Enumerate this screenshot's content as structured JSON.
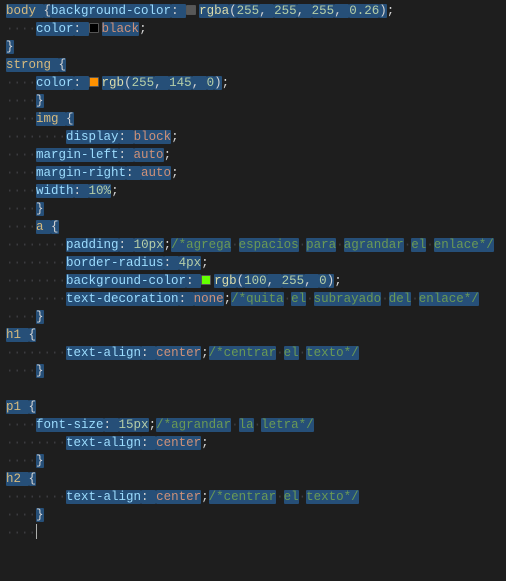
{
  "lines": [
    {
      "indent": 0,
      "segs": [
        {
          "t": "body ",
          "c": "sel",
          "hl": true
        },
        {
          "t": "{",
          "c": "punc",
          "hl": true
        },
        {
          "t": "background-color",
          "c": "prop",
          "hl": true
        },
        {
          "t": ": ",
          "c": "punc",
          "hl": true
        },
        {
          "swatch": "rgba(255,255,255,0.26)",
          "hl": true
        },
        {
          "t": "rgba",
          "c": "func",
          "hl": true
        },
        {
          "t": "(",
          "c": "punc",
          "hl": true
        },
        {
          "t": "255",
          "c": "num",
          "hl": true
        },
        {
          "t": ", ",
          "c": "punc",
          "hl": true
        },
        {
          "t": "255",
          "c": "num",
          "hl": true
        },
        {
          "t": ", ",
          "c": "punc",
          "hl": true
        },
        {
          "t": "255",
          "c": "num",
          "hl": true
        },
        {
          "t": ", ",
          "c": "punc",
          "hl": true
        },
        {
          "t": "0.26",
          "c": "num",
          "hl": true
        },
        {
          "t": ")",
          "c": "punc",
          "hl": true
        },
        {
          "t": ";",
          "c": "punc"
        }
      ]
    },
    {
      "indent": 1,
      "segs": [
        {
          "t": "color",
          "c": "prop",
          "hl": true
        },
        {
          "t": ": ",
          "c": "punc",
          "hl": true
        },
        {
          "swatch": "black",
          "hl": true
        },
        {
          "t": "black",
          "c": "val",
          "hl": true
        },
        {
          "t": ";",
          "c": "punc"
        }
      ]
    },
    {
      "indent": 0,
      "segs": [
        {
          "t": "}",
          "c": "punc",
          "hl": true
        }
      ]
    },
    {
      "indent": 0,
      "segs": [
        {
          "t": "strong ",
          "c": "sel",
          "hl": true
        },
        {
          "t": "{",
          "c": "punc",
          "hl": true
        }
      ]
    },
    {
      "indent": 1,
      "segs": [
        {
          "t": "color",
          "c": "prop",
          "hl": true
        },
        {
          "t": ": ",
          "c": "punc",
          "hl": true
        },
        {
          "swatch": "rgb(255,145,0)",
          "hl": true
        },
        {
          "t": "rgb",
          "c": "func",
          "hl": true
        },
        {
          "t": "(",
          "c": "punc",
          "hl": true
        },
        {
          "t": "255",
          "c": "num",
          "hl": true
        },
        {
          "t": ", ",
          "c": "punc",
          "hl": true
        },
        {
          "t": "145",
          "c": "num",
          "hl": true
        },
        {
          "t": ", ",
          "c": "punc",
          "hl": true
        },
        {
          "t": "0",
          "c": "num",
          "hl": true
        },
        {
          "t": ")",
          "c": "punc",
          "hl": true
        },
        {
          "t": ";",
          "c": "punc"
        }
      ]
    },
    {
      "indent": 1,
      "segs": [
        {
          "t": "}",
          "c": "punc",
          "hl": true
        }
      ]
    },
    {
      "indent": 1,
      "segs": [
        {
          "t": "img ",
          "c": "sel",
          "hl": true
        },
        {
          "t": "{",
          "c": "punc",
          "hl": true
        }
      ]
    },
    {
      "indent": 2,
      "segs": [
        {
          "t": "display",
          "c": "prop",
          "hl": true
        },
        {
          "t": ": ",
          "c": "punc",
          "hl": true
        },
        {
          "t": "block",
          "c": "val",
          "hl": true
        },
        {
          "t": ";",
          "c": "punc"
        }
      ]
    },
    {
      "indent": 1,
      "segs": [
        {
          "t": "margin-left",
          "c": "prop",
          "hl": true
        },
        {
          "t": ": ",
          "c": "punc",
          "hl": true
        },
        {
          "t": "auto",
          "c": "val",
          "hl": true
        },
        {
          "t": ";",
          "c": "punc"
        }
      ]
    },
    {
      "indent": 1,
      "segs": [
        {
          "t": "margin-right",
          "c": "prop",
          "hl": true
        },
        {
          "t": ": ",
          "c": "punc",
          "hl": true
        },
        {
          "t": "auto",
          "c": "val",
          "hl": true
        },
        {
          "t": ";",
          "c": "punc"
        }
      ]
    },
    {
      "indent": 1,
      "segs": [
        {
          "t": "width",
          "c": "prop",
          "hl": true
        },
        {
          "t": ": ",
          "c": "punc",
          "hl": true
        },
        {
          "t": "10%",
          "c": "num",
          "hl": true
        },
        {
          "t": ";",
          "c": "punc"
        }
      ]
    },
    {
      "indent": 1,
      "segs": [
        {
          "t": "}",
          "c": "punc",
          "hl": true
        }
      ]
    },
    {
      "indent": 1,
      "segs": [
        {
          "t": "a ",
          "c": "sel",
          "hl": true
        },
        {
          "t": "{",
          "c": "punc",
          "hl": true
        }
      ]
    },
    {
      "indent": 2,
      "segs": [
        {
          "t": "padding",
          "c": "prop",
          "hl": true
        },
        {
          "t": ": ",
          "c": "punc",
          "hl": true
        },
        {
          "t": "10px",
          "c": "num",
          "hl": true
        },
        {
          "t": ";",
          "c": "punc"
        },
        {
          "t": "/*agrega",
          "c": "comment",
          "hl": true
        },
        {
          "ws": true
        },
        {
          "t": "espacios",
          "c": "comment",
          "hl": true
        },
        {
          "ws": true
        },
        {
          "t": "para",
          "c": "comment",
          "hl": true
        },
        {
          "ws": true
        },
        {
          "t": "agrandar",
          "c": "comment",
          "hl": true
        },
        {
          "ws": true
        },
        {
          "t": "el",
          "c": "comment",
          "hl": true
        },
        {
          "ws": true
        },
        {
          "t": "enlace*/",
          "c": "comment",
          "hl": true
        }
      ]
    },
    {
      "indent": 2,
      "segs": [
        {
          "t": "border-radius",
          "c": "prop",
          "hl": true
        },
        {
          "t": ": ",
          "c": "punc",
          "hl": true
        },
        {
          "t": "4px",
          "c": "num",
          "hl": true
        },
        {
          "t": ";",
          "c": "punc"
        }
      ]
    },
    {
      "indent": 2,
      "segs": [
        {
          "t": "background-color",
          "c": "prop",
          "hl": true
        },
        {
          "t": ": ",
          "c": "punc",
          "hl": true
        },
        {
          "swatch": "rgb(100,255,0)",
          "hl": true
        },
        {
          "t": "rgb",
          "c": "func",
          "hl": true
        },
        {
          "t": "(",
          "c": "punc",
          "hl": true
        },
        {
          "t": "100",
          "c": "num",
          "hl": true
        },
        {
          "t": ", ",
          "c": "punc",
          "hl": true
        },
        {
          "t": "255",
          "c": "num",
          "hl": true
        },
        {
          "t": ", ",
          "c": "punc",
          "hl": true
        },
        {
          "t": "0",
          "c": "num",
          "hl": true
        },
        {
          "t": ")",
          "c": "punc",
          "hl": true
        },
        {
          "t": ";",
          "c": "punc"
        }
      ]
    },
    {
      "indent": 2,
      "segs": [
        {
          "t": "text-decoration",
          "c": "prop",
          "hl": true
        },
        {
          "t": ": ",
          "c": "punc",
          "hl": true
        },
        {
          "t": "none",
          "c": "val",
          "hl": true
        },
        {
          "t": ";",
          "c": "punc"
        },
        {
          "t": "/*quita",
          "c": "comment",
          "hl": true
        },
        {
          "ws": true
        },
        {
          "t": "el",
          "c": "comment",
          "hl": true
        },
        {
          "ws": true
        },
        {
          "t": "subrayado",
          "c": "comment",
          "hl": true
        },
        {
          "ws": true
        },
        {
          "t": "del",
          "c": "comment",
          "hl": true
        },
        {
          "ws": true
        },
        {
          "t": "enlace*/",
          "c": "comment",
          "hl": true
        }
      ]
    },
    {
      "indent": 1,
      "segs": [
        {
          "t": "}",
          "c": "punc",
          "hl": true
        }
      ]
    },
    {
      "indent": 0,
      "segs": [
        {
          "t": "h1 ",
          "c": "sel",
          "hl": true
        },
        {
          "t": "{",
          "c": "punc",
          "hl": true
        }
      ]
    },
    {
      "indent": 2,
      "segs": [
        {
          "t": "text-align",
          "c": "prop",
          "hl": true
        },
        {
          "t": ": ",
          "c": "punc",
          "hl": true
        },
        {
          "t": "center",
          "c": "val",
          "hl": true
        },
        {
          "t": ";",
          "c": "punc"
        },
        {
          "t": "/*centrar",
          "c": "comment",
          "hl": true
        },
        {
          "ws": true
        },
        {
          "t": "el",
          "c": "comment",
          "hl": true
        },
        {
          "ws": true
        },
        {
          "t": "texto*/",
          "c": "comment",
          "hl": true
        }
      ]
    },
    {
      "indent": 1,
      "segs": [
        {
          "t": "}",
          "c": "punc",
          "hl": true
        }
      ]
    },
    {
      "indent": 0,
      "segs": []
    },
    {
      "indent": 0,
      "segs": [
        {
          "t": "p1 ",
          "c": "sel",
          "hl": true
        },
        {
          "t": "{",
          "c": "punc",
          "hl": true
        }
      ]
    },
    {
      "indent": 1,
      "segs": [
        {
          "t": "font-size",
          "c": "prop",
          "hl": true
        },
        {
          "t": ": ",
          "c": "punc",
          "hl": true
        },
        {
          "t": "15px",
          "c": "num",
          "hl": true
        },
        {
          "t": ";",
          "c": "punc"
        },
        {
          "t": "/*agrandar",
          "c": "comment",
          "hl": true
        },
        {
          "ws": true
        },
        {
          "t": "la",
          "c": "comment",
          "hl": true
        },
        {
          "ws": true
        },
        {
          "t": "letra*/",
          "c": "comment",
          "hl": true
        }
      ]
    },
    {
      "indent": 2,
      "segs": [
        {
          "t": "text-align",
          "c": "prop",
          "hl": true
        },
        {
          "t": ": ",
          "c": "punc",
          "hl": true
        },
        {
          "t": "center",
          "c": "val",
          "hl": true
        },
        {
          "t": ";",
          "c": "punc"
        }
      ]
    },
    {
      "indent": 1,
      "segs": [
        {
          "t": "}",
          "c": "punc",
          "hl": true
        }
      ]
    },
    {
      "indent": 0,
      "segs": [
        {
          "t": "h2 ",
          "c": "sel",
          "hl": true
        },
        {
          "t": "{",
          "c": "punc",
          "hl": true
        }
      ]
    },
    {
      "indent": 2,
      "segs": [
        {
          "t": "text-align",
          "c": "prop",
          "hl": true
        },
        {
          "t": ": ",
          "c": "punc",
          "hl": true
        },
        {
          "t": "center",
          "c": "val",
          "hl": true
        },
        {
          "t": ";",
          "c": "punc"
        },
        {
          "t": "/*centrar",
          "c": "comment",
          "hl": true
        },
        {
          "ws": true
        },
        {
          "t": "el",
          "c": "comment",
          "hl": true
        },
        {
          "ws": true
        },
        {
          "t": "texto*/",
          "c": "comment",
          "hl": true
        }
      ]
    },
    {
      "indent": 1,
      "segs": [
        {
          "t": "}",
          "c": "punc",
          "hl": true
        }
      ]
    },
    {
      "indent": 1,
      "segs": [],
      "cursor": true
    }
  ],
  "indentUnit": "····",
  "wsDot": "·"
}
